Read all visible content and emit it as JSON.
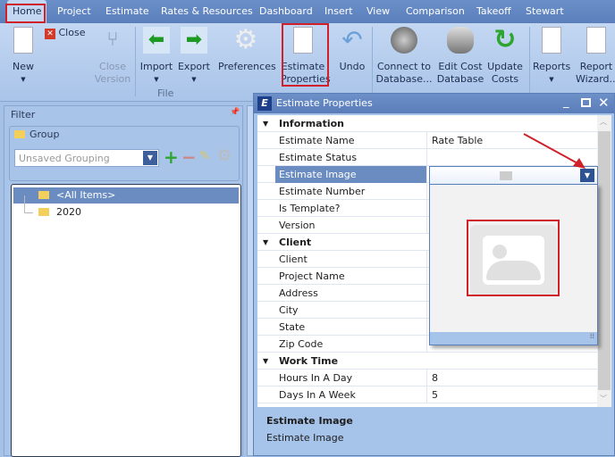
{
  "tabs": [
    "Home",
    "Project",
    "Estimate",
    "Rates & Resources",
    "Dashboard",
    "Insert",
    "View",
    "Comparison",
    "Takeoff",
    "Stewart"
  ],
  "ribbon": {
    "new": "New",
    "close": "Close",
    "close_version": [
      "Close",
      "Version"
    ],
    "import": "Import",
    "export": "Export",
    "preferences": "Preferences",
    "estimate_properties": [
      "Estimate",
      "Properties"
    ],
    "undo": "Undo",
    "connect": [
      "Connect to",
      "Database..."
    ],
    "edit_cost": [
      "Edit Cost",
      "Database"
    ],
    "update_costs": [
      "Update",
      "Costs"
    ],
    "reports": "Reports",
    "report_wizard": [
      "Report",
      "Wizard..."
    ],
    "group_file": "File"
  },
  "filter": {
    "title": "Filter",
    "group_title": "Group",
    "grouping_placeholder": "Unsaved Grouping",
    "tree": [
      "<All Items>",
      "2020"
    ]
  },
  "dialog": {
    "title": "Estimate Properties",
    "sections": [
      {
        "name": "Information",
        "rows": [
          {
            "label": "Estimate Name",
            "value": "Rate Table"
          },
          {
            "label": "Estimate Status",
            "value": ""
          },
          {
            "label": "Estimate Image",
            "value": ""
          },
          {
            "label": "Estimate Number",
            "value": ""
          },
          {
            "label": "Is Template?",
            "value": ""
          },
          {
            "label": "Version",
            "value": ""
          }
        ]
      },
      {
        "name": "Client",
        "rows": [
          {
            "label": "Client",
            "value": ""
          },
          {
            "label": "Project Name",
            "value": ""
          },
          {
            "label": "Address",
            "value": ""
          },
          {
            "label": "City",
            "value": ""
          },
          {
            "label": "State",
            "value": ""
          },
          {
            "label": "Zip Code",
            "value": ""
          }
        ]
      },
      {
        "name": "Work Time",
        "rows": [
          {
            "label": "Hours In A Day",
            "value": "8"
          },
          {
            "label": "Days In A Week",
            "value": "5"
          }
        ]
      }
    ],
    "description": {
      "title": "Estimate Image",
      "text": "Estimate Image"
    }
  },
  "colors": {
    "accent": "#5a7fbb",
    "highlight": "#d0202a",
    "selected_row": "#6a8cc0"
  }
}
